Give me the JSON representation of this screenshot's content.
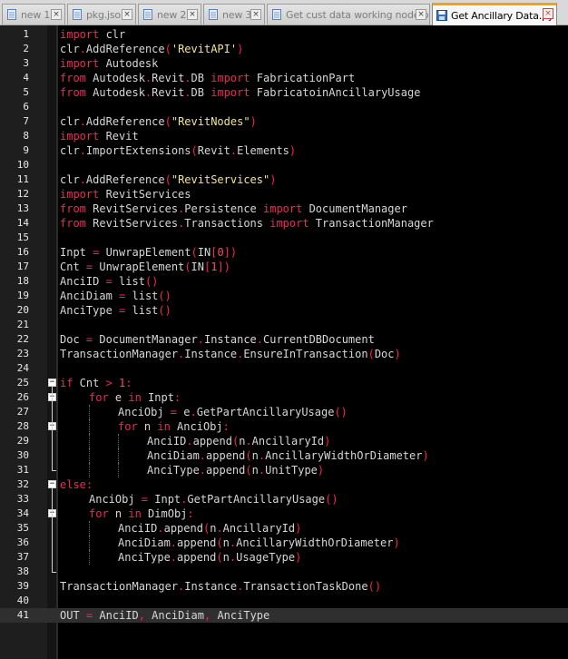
{
  "tabs": [
    {
      "label": "new 1",
      "icon": "document-icon",
      "active": false
    },
    {
      "label": "pkg.json",
      "icon": "document-icon",
      "active": false
    },
    {
      "label": "new 2",
      "icon": "document-icon",
      "active": false
    },
    {
      "label": "new 3",
      "icon": "document-icon",
      "active": false
    },
    {
      "label": "Get cust data working node.py",
      "icon": "document-icon",
      "active": false
    },
    {
      "label": "Get Ancillary Data.py",
      "icon": "save-icon",
      "active": true
    }
  ],
  "close_glyph": "×",
  "fold_open_glyph": "−",
  "current_line": 41,
  "colors": {
    "keyword": "#ff1e5a",
    "string": "#f0e68c",
    "identifier": "#d7d7d7",
    "background": "#000000",
    "active_tab_accent": "#f5a30a"
  },
  "lines": [
    {
      "n": "1",
      "indent": 0,
      "tokens": [
        [
          "kw",
          "import"
        ],
        [
          "id",
          " clr"
        ]
      ]
    },
    {
      "n": "2",
      "indent": 0,
      "tokens": [
        [
          "id",
          "clr"
        ],
        [
          "op",
          "."
        ],
        [
          "id",
          "AddReference"
        ],
        [
          "op",
          "("
        ],
        [
          "str",
          "'RevitAPI'"
        ],
        [
          "op",
          ")"
        ]
      ]
    },
    {
      "n": "3",
      "indent": 0,
      "tokens": [
        [
          "kw",
          "import"
        ],
        [
          "id",
          " Autodesk"
        ]
      ]
    },
    {
      "n": "4",
      "indent": 0,
      "tokens": [
        [
          "kw",
          "from"
        ],
        [
          "id",
          " Autodesk"
        ],
        [
          "op",
          "."
        ],
        [
          "id",
          "Revit"
        ],
        [
          "op",
          "."
        ],
        [
          "id",
          "DB "
        ],
        [
          "kw",
          "import"
        ],
        [
          "id",
          " FabricationPart"
        ]
      ]
    },
    {
      "n": "5",
      "indent": 0,
      "tokens": [
        [
          "kw",
          "from"
        ],
        [
          "id",
          " Autodesk"
        ],
        [
          "op",
          "."
        ],
        [
          "id",
          "Revit"
        ],
        [
          "op",
          "."
        ],
        [
          "id",
          "DB "
        ],
        [
          "kw",
          "import"
        ],
        [
          "id",
          " FabricatoinAncillaryUsage"
        ]
      ]
    },
    {
      "n": "6",
      "indent": 0,
      "tokens": []
    },
    {
      "n": "7",
      "indent": 0,
      "tokens": [
        [
          "id",
          "clr"
        ],
        [
          "op",
          "."
        ],
        [
          "id",
          "AddReference"
        ],
        [
          "op",
          "("
        ],
        [
          "str",
          "\"RevitNodes\""
        ],
        [
          "op",
          ")"
        ]
      ]
    },
    {
      "n": "8",
      "indent": 0,
      "tokens": [
        [
          "kw",
          "import"
        ],
        [
          "id",
          " Revit"
        ]
      ]
    },
    {
      "n": "9",
      "indent": 0,
      "tokens": [
        [
          "id",
          "clr"
        ],
        [
          "op",
          "."
        ],
        [
          "id",
          "ImportExtensions"
        ],
        [
          "op",
          "("
        ],
        [
          "id",
          "Revit"
        ],
        [
          "op",
          "."
        ],
        [
          "id",
          "Elements"
        ],
        [
          "op",
          ")"
        ]
      ]
    },
    {
      "n": "10",
      "indent": 0,
      "tokens": []
    },
    {
      "n": "11",
      "indent": 0,
      "tokens": [
        [
          "id",
          "clr"
        ],
        [
          "op",
          "."
        ],
        [
          "id",
          "AddReference"
        ],
        [
          "op",
          "("
        ],
        [
          "str",
          "\"RevitServices\""
        ],
        [
          "op",
          ")"
        ]
      ]
    },
    {
      "n": "12",
      "indent": 0,
      "tokens": [
        [
          "kw",
          "import"
        ],
        [
          "id",
          " RevitServices"
        ]
      ]
    },
    {
      "n": "13",
      "indent": 0,
      "tokens": [
        [
          "kw",
          "from"
        ],
        [
          "id",
          " RevitServices"
        ],
        [
          "op",
          "."
        ],
        [
          "id",
          "Persistence "
        ],
        [
          "kw",
          "import"
        ],
        [
          "id",
          " DocumentManager"
        ]
      ]
    },
    {
      "n": "14",
      "indent": 0,
      "tokens": [
        [
          "kw",
          "from"
        ],
        [
          "id",
          " RevitServices"
        ],
        [
          "op",
          "."
        ],
        [
          "id",
          "Transactions "
        ],
        [
          "kw",
          "import"
        ],
        [
          "id",
          " TransactionManager"
        ]
      ]
    },
    {
      "n": "15",
      "indent": 0,
      "tokens": []
    },
    {
      "n": "16",
      "indent": 0,
      "tokens": [
        [
          "id",
          "Inpt "
        ],
        [
          "op",
          "="
        ],
        [
          "id",
          " UnwrapElement"
        ],
        [
          "op",
          "("
        ],
        [
          "id",
          "IN"
        ],
        [
          "op",
          "["
        ],
        [
          "num",
          "0"
        ],
        [
          "op",
          "])"
        ]
      ]
    },
    {
      "n": "17",
      "indent": 0,
      "tokens": [
        [
          "id",
          "Cnt "
        ],
        [
          "op",
          "="
        ],
        [
          "id",
          " UnwrapElement"
        ],
        [
          "op",
          "("
        ],
        [
          "id",
          "IN"
        ],
        [
          "op",
          "["
        ],
        [
          "num",
          "1"
        ],
        [
          "op",
          "])"
        ]
      ]
    },
    {
      "n": "18",
      "indent": 0,
      "tokens": [
        [
          "id",
          "AnciID "
        ],
        [
          "op",
          "="
        ],
        [
          "id",
          " list"
        ],
        [
          "op",
          "()"
        ]
      ]
    },
    {
      "n": "19",
      "indent": 0,
      "tokens": [
        [
          "id",
          "AnciDiam "
        ],
        [
          "op",
          "="
        ],
        [
          "id",
          " list"
        ],
        [
          "op",
          "()"
        ]
      ]
    },
    {
      "n": "20",
      "indent": 0,
      "tokens": [
        [
          "id",
          "AnciType "
        ],
        [
          "op",
          "="
        ],
        [
          "id",
          " list"
        ],
        [
          "op",
          "()"
        ]
      ]
    },
    {
      "n": "21",
      "indent": 0,
      "tokens": []
    },
    {
      "n": "22",
      "indent": 0,
      "tokens": [
        [
          "id",
          "Doc "
        ],
        [
          "op",
          "="
        ],
        [
          "id",
          " DocumentManager"
        ],
        [
          "op",
          "."
        ],
        [
          "id",
          "Instance"
        ],
        [
          "op",
          "."
        ],
        [
          "id",
          "CurrentDBDocument"
        ]
      ]
    },
    {
      "n": "23",
      "indent": 0,
      "tokens": [
        [
          "id",
          "TransactionManager"
        ],
        [
          "op",
          "."
        ],
        [
          "id",
          "Instance"
        ],
        [
          "op",
          "."
        ],
        [
          "id",
          "EnsureInTransaction"
        ],
        [
          "op",
          "("
        ],
        [
          "id",
          "Doc"
        ],
        [
          "op",
          ")"
        ]
      ]
    },
    {
      "n": "24",
      "indent": 0,
      "tokens": []
    },
    {
      "n": "25",
      "indent": 0,
      "fold": true,
      "tokens": [
        [
          "kw",
          "if"
        ],
        [
          "id",
          " Cnt "
        ],
        [
          "op",
          ">"
        ],
        [
          "num",
          " 1"
        ],
        [
          "op",
          ":"
        ]
      ]
    },
    {
      "n": "26",
      "indent": 1,
      "fold": true,
      "tokens": [
        [
          "kw",
          "for"
        ],
        [
          "id",
          " e "
        ],
        [
          "kw",
          "in"
        ],
        [
          "id",
          " Inpt"
        ],
        [
          "op",
          ":"
        ]
      ]
    },
    {
      "n": "27",
      "indent": 2,
      "tokens": [
        [
          "id",
          "AnciObj "
        ],
        [
          "op",
          "="
        ],
        [
          "id",
          " e"
        ],
        [
          "op",
          "."
        ],
        [
          "id",
          "GetPartAncillaryUsage"
        ],
        [
          "op",
          "()"
        ]
      ]
    },
    {
      "n": "28",
      "indent": 2,
      "fold": true,
      "tokens": [
        [
          "kw",
          "for"
        ],
        [
          "id",
          " n "
        ],
        [
          "kw",
          "in"
        ],
        [
          "id",
          " AnciObj"
        ],
        [
          "op",
          ":"
        ]
      ]
    },
    {
      "n": "29",
      "indent": 3,
      "tokens": [
        [
          "id",
          "AnciID"
        ],
        [
          "op",
          "."
        ],
        [
          "id",
          "append"
        ],
        [
          "op",
          "("
        ],
        [
          "id",
          "n"
        ],
        [
          "op",
          "."
        ],
        [
          "id",
          "AncillaryId"
        ],
        [
          "op",
          ")"
        ]
      ]
    },
    {
      "n": "30",
      "indent": 3,
      "tokens": [
        [
          "id",
          "AnciDiam"
        ],
        [
          "op",
          "."
        ],
        [
          "id",
          "append"
        ],
        [
          "op",
          "("
        ],
        [
          "id",
          "n"
        ],
        [
          "op",
          "."
        ],
        [
          "id",
          "AncillaryWidthOrDiameter"
        ],
        [
          "op",
          ")"
        ]
      ]
    },
    {
      "n": "31",
      "indent": 3,
      "tokens": [
        [
          "id",
          "AnciType"
        ],
        [
          "op",
          "."
        ],
        [
          "id",
          "append"
        ],
        [
          "op",
          "("
        ],
        [
          "id",
          "n"
        ],
        [
          "op",
          "."
        ],
        [
          "id",
          "UnitType"
        ],
        [
          "op",
          ")"
        ]
      ]
    },
    {
      "n": "32",
      "indent": 0,
      "fold": true,
      "tokens": [
        [
          "kw",
          "else"
        ],
        [
          "op",
          ":"
        ]
      ]
    },
    {
      "n": "33",
      "indent": 1,
      "tokens": [
        [
          "id",
          "AnciObj "
        ],
        [
          "op",
          "="
        ],
        [
          "id",
          " Inpt"
        ],
        [
          "op",
          "."
        ],
        [
          "id",
          "GetPartAncillaryUsage"
        ],
        [
          "op",
          "()"
        ]
      ]
    },
    {
      "n": "34",
      "indent": 1,
      "fold": true,
      "tokens": [
        [
          "kw",
          "for"
        ],
        [
          "id",
          " n "
        ],
        [
          "kw",
          "in"
        ],
        [
          "id",
          " DimObj"
        ],
        [
          "op",
          ":"
        ]
      ]
    },
    {
      "n": "35",
      "indent": 2,
      "tokens": [
        [
          "id",
          "AnciID"
        ],
        [
          "op",
          "."
        ],
        [
          "id",
          "append"
        ],
        [
          "op",
          "("
        ],
        [
          "id",
          "n"
        ],
        [
          "op",
          "."
        ],
        [
          "id",
          "AncillaryId"
        ],
        [
          "op",
          ")"
        ]
      ]
    },
    {
      "n": "36",
      "indent": 2,
      "tokens": [
        [
          "id",
          "AnciDiam"
        ],
        [
          "op",
          "."
        ],
        [
          "id",
          "append"
        ],
        [
          "op",
          "("
        ],
        [
          "id",
          "n"
        ],
        [
          "op",
          "."
        ],
        [
          "id",
          "AncillaryWidthOrDiameter"
        ],
        [
          "op",
          ")"
        ]
      ]
    },
    {
      "n": "37",
      "indent": 2,
      "tokens": [
        [
          "id",
          "AnciType"
        ],
        [
          "op",
          "."
        ],
        [
          "id",
          "append"
        ],
        [
          "op",
          "("
        ],
        [
          "id",
          "n"
        ],
        [
          "op",
          "."
        ],
        [
          "id",
          "UsageType"
        ],
        [
          "op",
          ")"
        ]
      ]
    },
    {
      "n": "38",
      "indent": 0,
      "tokens": []
    },
    {
      "n": "39",
      "indent": 0,
      "tokens": [
        [
          "id",
          "TransactionManager"
        ],
        [
          "op",
          "."
        ],
        [
          "id",
          "Instance"
        ],
        [
          "op",
          "."
        ],
        [
          "id",
          "TransactionTaskDone"
        ],
        [
          "op",
          "()"
        ]
      ]
    },
    {
      "n": "40",
      "indent": 0,
      "tokens": []
    },
    {
      "n": "41",
      "indent": 0,
      "tokens": [
        [
          "id",
          "OUT "
        ],
        [
          "op",
          "="
        ],
        [
          "id",
          " AnciID"
        ],
        [
          "op",
          ","
        ],
        [
          "id",
          " AnciDiam"
        ],
        [
          "op",
          ","
        ],
        [
          "id",
          " AnciType"
        ]
      ]
    }
  ]
}
